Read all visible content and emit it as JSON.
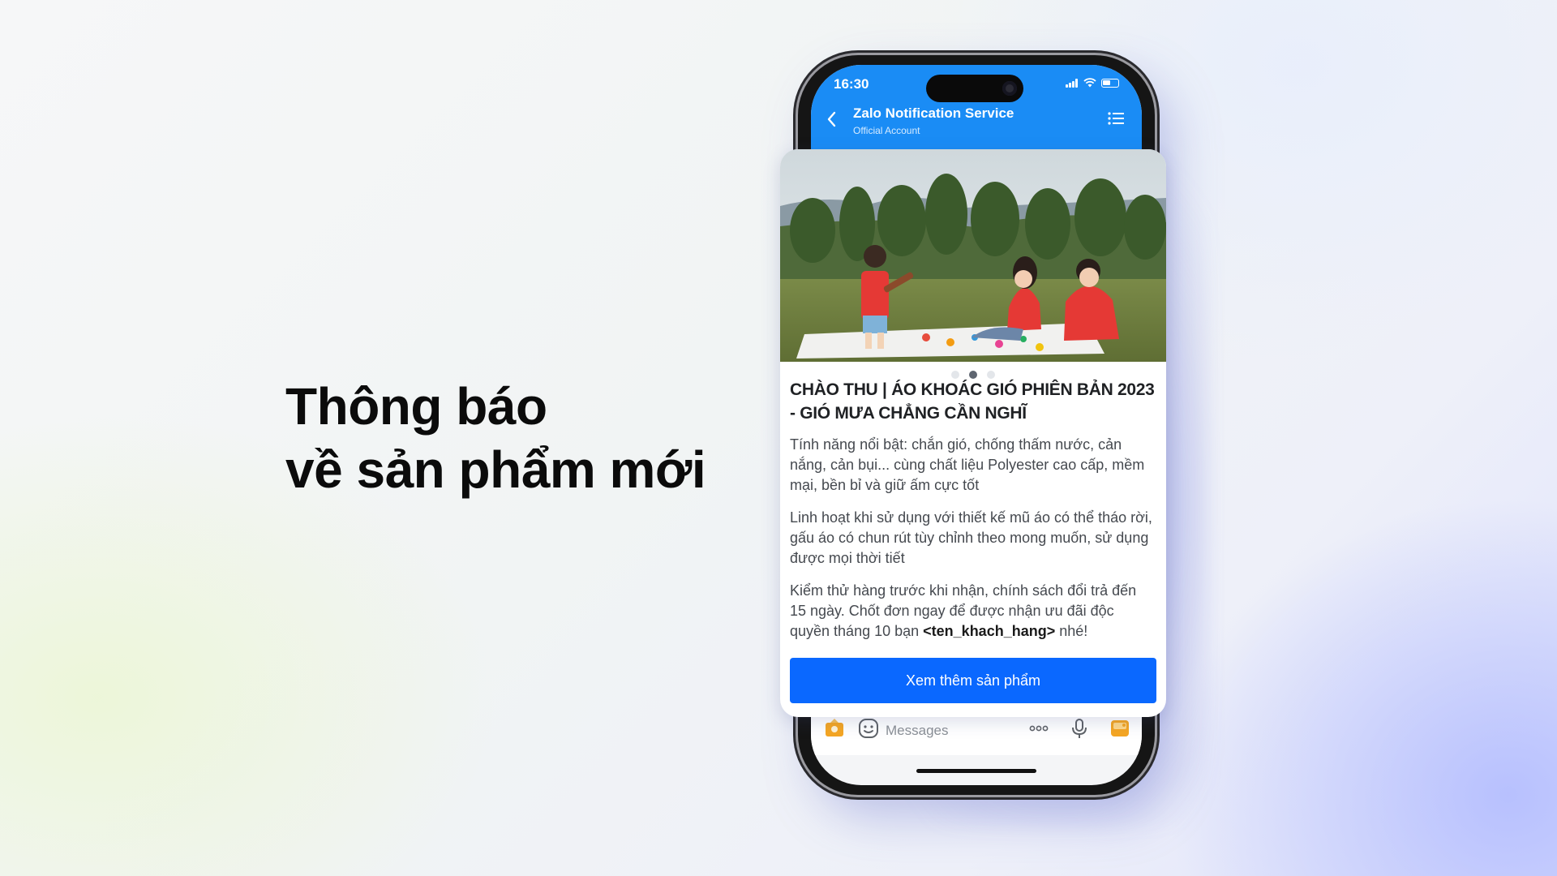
{
  "headline": {
    "line1": "Thông báo",
    "line2": "về sản phẩm mới"
  },
  "phone": {
    "status_time": "16:30",
    "header": {
      "title": "Zalo Notification Service",
      "subtitle": "Official Account",
      "back_icon": "chevron-left-icon",
      "menu_icon": "list-icon"
    },
    "message": {
      "carousel": {
        "count": 3,
        "active": 2
      },
      "title": "CHÀO THU | ÁO KHOÁC GIÓ PHIÊN BẢN 2023 - GIÓ MƯA CHẲNG CẦN NGHĨ",
      "paragraph1": "Tính năng nổi bật: chắn gió, chống thấm nước, cản nắng, cản bụi... cùng chất liệu Polyester cao cấp, mềm mại, bền bỉ và giữ ấm cực tốt",
      "paragraph2": "Linh hoạt khi sử dụng với thiết kế mũ áo có thể tháo rời, gấu áo có chun rút tùy chỉnh theo mong muốn, sử dụng được mọi thời tiết",
      "paragraph3_before": "Kiểm thử hàng trước khi nhận, chính sách đổi trả đến 15 ngày. Chốt đơn ngay để được nhận ưu đãi độc quyền tháng 10 bạn ",
      "paragraph3_var": "<ten_khach_hang>",
      "paragraph3_after": " nhé!",
      "cta_label": "Xem thêm sản phẩm"
    },
    "input_bar": {
      "placeholder": "Messages",
      "icons": [
        "sticker-icon",
        "emoji-icon",
        "more-icon",
        "microphone-icon",
        "image-icon"
      ]
    },
    "colors": {
      "header_blue": "#1a8cf5",
      "button_blue": "#0a68ff",
      "icon_orange": "#f5a623"
    }
  }
}
